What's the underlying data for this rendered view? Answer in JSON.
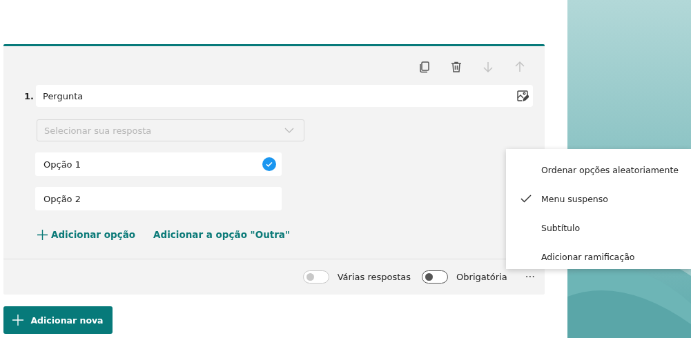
{
  "toolbar": [
    {
      "kind": "copy",
      "disabled": false
    },
    {
      "kind": "delete",
      "disabled": false
    },
    {
      "kind": "down",
      "disabled": true
    },
    {
      "kind": "up",
      "disabled": true
    }
  ],
  "question": {
    "number": "1.",
    "placeholder": "Pergunta"
  },
  "answer_dropdown": {
    "placeholder": "Selecionar sua resposta"
  },
  "options": [
    {
      "label": "Opção 1",
      "correct": true
    },
    {
      "label": "Opção 2",
      "correct": false
    }
  ],
  "add_option": "Adicionar opção",
  "add_other": "Adicionar a opção \"Outra\"",
  "toggles": [
    {
      "label": "Várias respostas",
      "on": false,
      "disabled": true
    },
    {
      "label": "Obrigatória",
      "on": false,
      "disabled": false
    }
  ],
  "more": "···",
  "add_new": "Adicionar nova",
  "menu": [
    {
      "label": "Ordenar opções aleatoriamente",
      "checked": false
    },
    {
      "label": "Menu suspenso",
      "checked": true
    },
    {
      "label": "Subtítulo",
      "checked": false
    },
    {
      "label": "Adicionar ramificação",
      "checked": false
    }
  ]
}
